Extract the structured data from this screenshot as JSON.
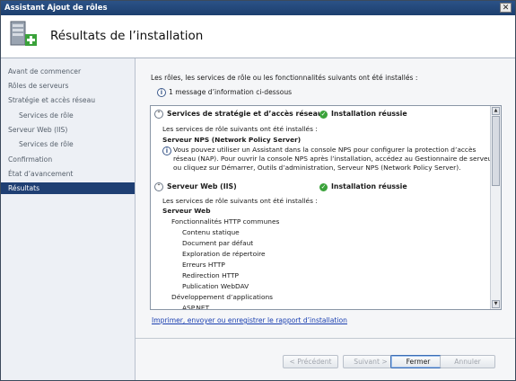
{
  "window": {
    "title": "Assistant Ajout de rôles",
    "close": "✕"
  },
  "header": {
    "title": "Résultats de l’installation"
  },
  "sidebar": {
    "items": [
      {
        "label": "Avant de commencer",
        "sub": false,
        "active": false
      },
      {
        "label": "Rôles de serveurs",
        "sub": false,
        "active": false
      },
      {
        "label": "Stratégie et accès réseau",
        "sub": false,
        "active": false
      },
      {
        "label": "Services de rôle",
        "sub": true,
        "active": false
      },
      {
        "label": "Serveur Web (IIS)",
        "sub": false,
        "active": false
      },
      {
        "label": "Services de rôle",
        "sub": true,
        "active": false
      },
      {
        "label": "Confirmation",
        "sub": false,
        "active": false
      },
      {
        "label": "État d’avancement",
        "sub": false,
        "active": false
      },
      {
        "label": "Résultats",
        "sub": false,
        "active": true
      }
    ]
  },
  "content": {
    "intro": "Les rôles, les services de rôle ou les fonctionnalités suivants ont été installés :",
    "info_message": "1 message d’information ci-dessous",
    "sections": [
      {
        "title": "Services de stratégie et d’accès réseau",
        "status": "Installation réussie",
        "lines": [
          {
            "text": "Les services de rôle suivants ont été installés :",
            "indent": 0,
            "bold": false
          },
          {
            "text": "Serveur NPS (Network Policy Server)",
            "indent": 0,
            "bold": true
          },
          {
            "text": "Vous pouvez utiliser un Assistant dans la console NPS pour configurer la protection d’accès",
            "indent": 12,
            "bold": false,
            "icon": true
          },
          {
            "text": "réseau (NAP). Pour ouvrir la console NPS après l’installation, accédez au Gestionnaire de serveur",
            "indent": 12,
            "bold": false
          },
          {
            "text": "ou cliquez sur Démarrer, Outils d’administration, Serveur NPS (Network Policy Server).",
            "indent": 12,
            "bold": false
          }
        ]
      },
      {
        "title": "Serveur Web (IIS)",
        "status": "Installation réussie",
        "lines": [
          {
            "text": "Les services de rôle suivants ont été installés :",
            "indent": 0,
            "bold": false
          },
          {
            "text": "Serveur Web",
            "indent": 0,
            "bold": true
          },
          {
            "text": "Fonctionnalités HTTP communes",
            "indent": 10,
            "bold": false
          },
          {
            "text": "Contenu statique",
            "indent": 22,
            "bold": false
          },
          {
            "text": "Document par défaut",
            "indent": 22,
            "bold": false
          },
          {
            "text": "Exploration de répertoire",
            "indent": 22,
            "bold": false
          },
          {
            "text": "Erreurs HTTP",
            "indent": 22,
            "bold": false
          },
          {
            "text": "Redirection HTTP",
            "indent": 22,
            "bold": false
          },
          {
            "text": "Publication WebDAV",
            "indent": 22,
            "bold": false
          },
          {
            "text": "Développement d’applications",
            "indent": 10,
            "bold": false
          },
          {
            "text": "ASP.NET",
            "indent": 22,
            "bold": false
          }
        ]
      }
    ],
    "link": "Imprimer, envoyer ou enregistrer le rapport d’installation"
  },
  "buttons": {
    "previous": "< Précédent",
    "next": "Suivant >",
    "close": "Fermer",
    "cancel": "Annuler"
  },
  "colors": {
    "title_bar": "#1d3f6e",
    "active_nav": "#1f3f73",
    "success": "#3aa23a",
    "link": "#1a3fb0"
  }
}
